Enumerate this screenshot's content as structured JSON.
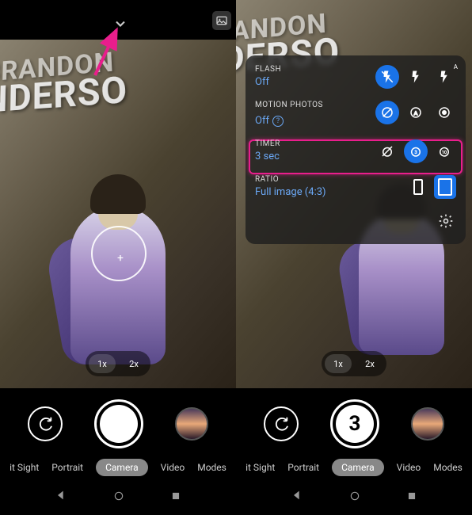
{
  "book": {
    "line1": "BRANDON",
    "line2": "NDERSO"
  },
  "zoom": {
    "z1": "1x",
    "z2": "2x"
  },
  "settings": {
    "flash": {
      "label": "FLASH",
      "value": "Off"
    },
    "motion": {
      "label": "MOTION PHOTOS",
      "value": "Off"
    },
    "timer": {
      "label": "TIMER",
      "value": "3 sec"
    },
    "ratio": {
      "label": "RATIO",
      "value": "Full image (4:3)"
    }
  },
  "shutter_count": "3",
  "modes": {
    "m0": "Night Sight",
    "m0b": "it Sight",
    "m1": "Portrait",
    "m2": "Camera",
    "m3": "Video",
    "m4": "Modes"
  }
}
